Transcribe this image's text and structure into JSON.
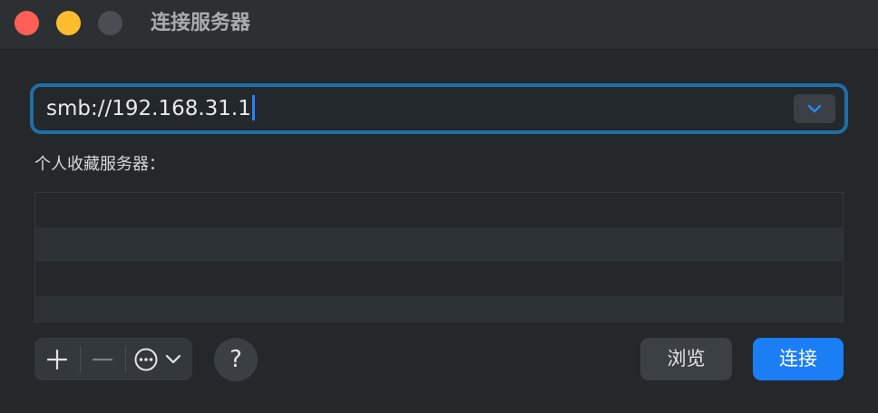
{
  "window": {
    "title": "连接服务器",
    "controls": {
      "close": "close-button",
      "minimize": "minimize-button",
      "zoom": "zoom-button"
    }
  },
  "address": {
    "value": "smb://192.168.31.1",
    "dropdown_icon": "chevron-down-icon"
  },
  "favorites": {
    "label": "个人收藏服务器：",
    "rows": [
      "",
      "",
      "",
      ""
    ]
  },
  "toolbar": {
    "add_icon": "plus-icon",
    "remove_icon": "minus-icon",
    "more_icon": "ellipsis-circle-icon",
    "more_chevron": "chevron-down-icon",
    "help_label": "?",
    "browse_label": "浏览",
    "connect_label": "连接"
  },
  "colors": {
    "accent": "#1b7ef5",
    "focus_ring": "#206fa6",
    "close": "#fe5f57",
    "minimize": "#febc2e"
  }
}
